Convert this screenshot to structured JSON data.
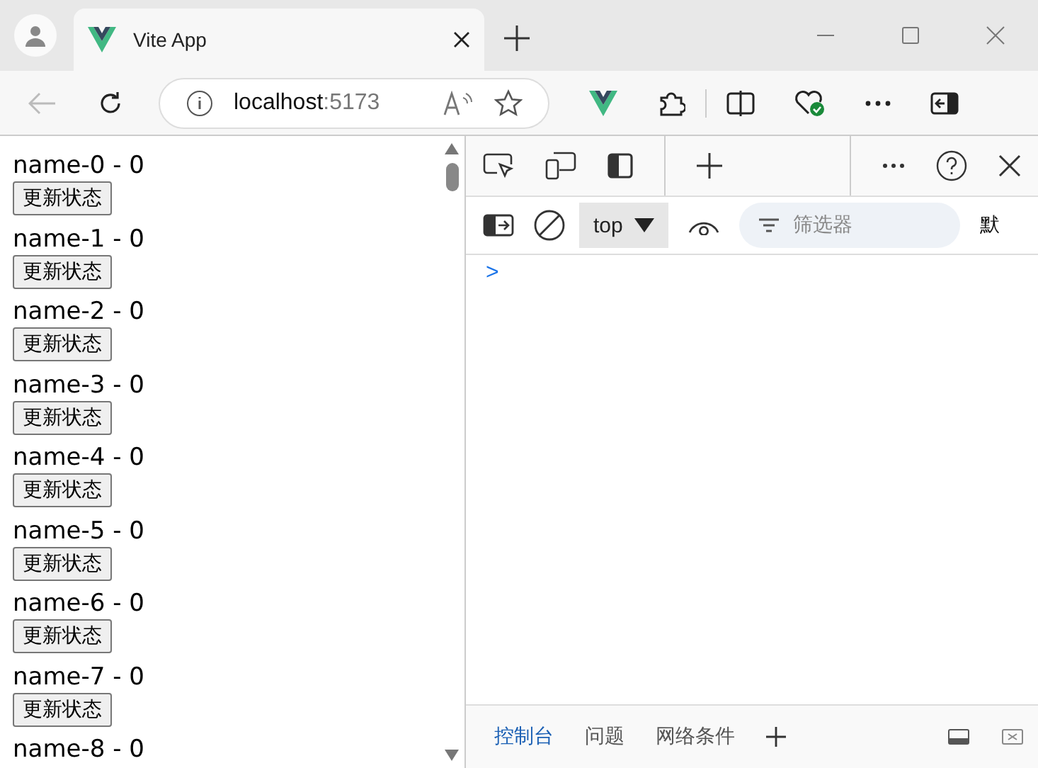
{
  "browser": {
    "tab_title": "Vite App",
    "address": {
      "host": "localhost",
      "port": ":5173"
    }
  },
  "page": {
    "items": [
      {
        "label": "name-0 - 0",
        "button": "更新状态"
      },
      {
        "label": "name-1 - 0",
        "button": "更新状态"
      },
      {
        "label": "name-2 - 0",
        "button": "更新状态"
      },
      {
        "label": "name-3 - 0",
        "button": "更新状态"
      },
      {
        "label": "name-4 - 0",
        "button": "更新状态"
      },
      {
        "label": "name-5 - 0",
        "button": "更新状态"
      },
      {
        "label": "name-6 - 0",
        "button": "更新状态"
      },
      {
        "label": "name-7 - 0",
        "button": "更新状态"
      },
      {
        "label": "name-8 - 0"
      }
    ]
  },
  "devtools": {
    "context": "top",
    "filter": {
      "placeholder": "筛选器"
    },
    "levels": "默",
    "prompt": ">",
    "tabs": [
      {
        "label": "控制台",
        "selected": true
      },
      {
        "label": "问题",
        "selected": false
      },
      {
        "label": "网络条件",
        "selected": false
      }
    ]
  }
}
